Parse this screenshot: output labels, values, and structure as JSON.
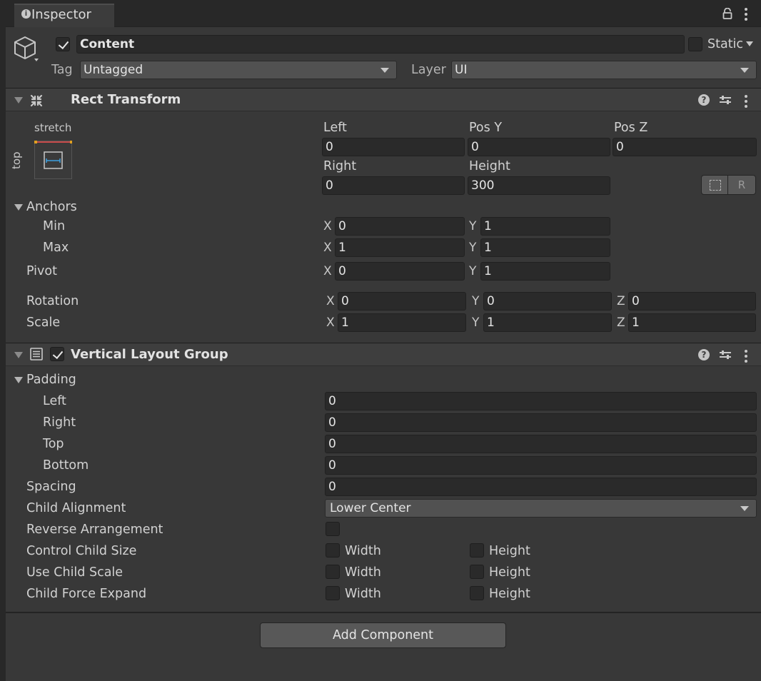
{
  "window": {
    "tab_title": "Inspector",
    "tab_icon": "info-icon",
    "lock_icon": "lock-icon",
    "menu_icon": "kebab-menu-icon"
  },
  "gameobject": {
    "icon": "gameobject-cube-icon",
    "active": true,
    "name": "Content",
    "static_label": "Static",
    "static_checked": false,
    "tag_label": "Tag",
    "tag_value": "Untagged",
    "layer_label": "Layer",
    "layer_value": "UI"
  },
  "rect_transform": {
    "title": "Rect Transform",
    "icon": "rect-transform-icon",
    "anchor_preset": {
      "horizontal": "stretch",
      "vertical": "top"
    },
    "fields": {
      "left_label": "Left",
      "left_value": "0",
      "posy_label": "Pos Y",
      "posy_value": "0",
      "posz_label": "Pos Z",
      "posz_value": "0",
      "right_label": "Right",
      "right_value": "0",
      "height_label": "Height",
      "height_value": "300"
    },
    "blueprint_button": "blueprint-mode-icon",
    "raw_button": "R",
    "anchors_label": "Anchors",
    "min_label": "Min",
    "min_x": "0",
    "min_y": "1",
    "max_label": "Max",
    "max_x": "1",
    "max_y": "1",
    "pivot_label": "Pivot",
    "pivot_x": "0",
    "pivot_y": "1",
    "rotation_label": "Rotation",
    "rotation": {
      "x": "0",
      "y": "0",
      "z": "0"
    },
    "scale_label": "Scale",
    "scale": {
      "x": "1",
      "y": "1",
      "z": "1"
    },
    "axis": {
      "x": "X",
      "y": "Y",
      "z": "Z"
    }
  },
  "vertical_layout_group": {
    "title": "Vertical Layout Group",
    "icon": "vertical-layout-icon",
    "enabled": true,
    "padding_label": "Padding",
    "padding": [
      {
        "label": "Left",
        "value": "0"
      },
      {
        "label": "Right",
        "value": "0"
      },
      {
        "label": "Top",
        "value": "0"
      },
      {
        "label": "Bottom",
        "value": "0"
      }
    ],
    "spacing_label": "Spacing",
    "spacing_value": "0",
    "child_alignment_label": "Child Alignment",
    "child_alignment_value": "Lower Center",
    "reverse_label": "Reverse Arrangement",
    "reverse_checked": false,
    "width_label": "Width",
    "height_label": "Height",
    "toggles": [
      {
        "label": "Control Child Size",
        "width": false,
        "height": false
      },
      {
        "label": "Use Child Scale",
        "width": false,
        "height": false
      },
      {
        "label": "Child Force Expand",
        "width": false,
        "height": false
      }
    ]
  },
  "add_component_label": "Add Component"
}
